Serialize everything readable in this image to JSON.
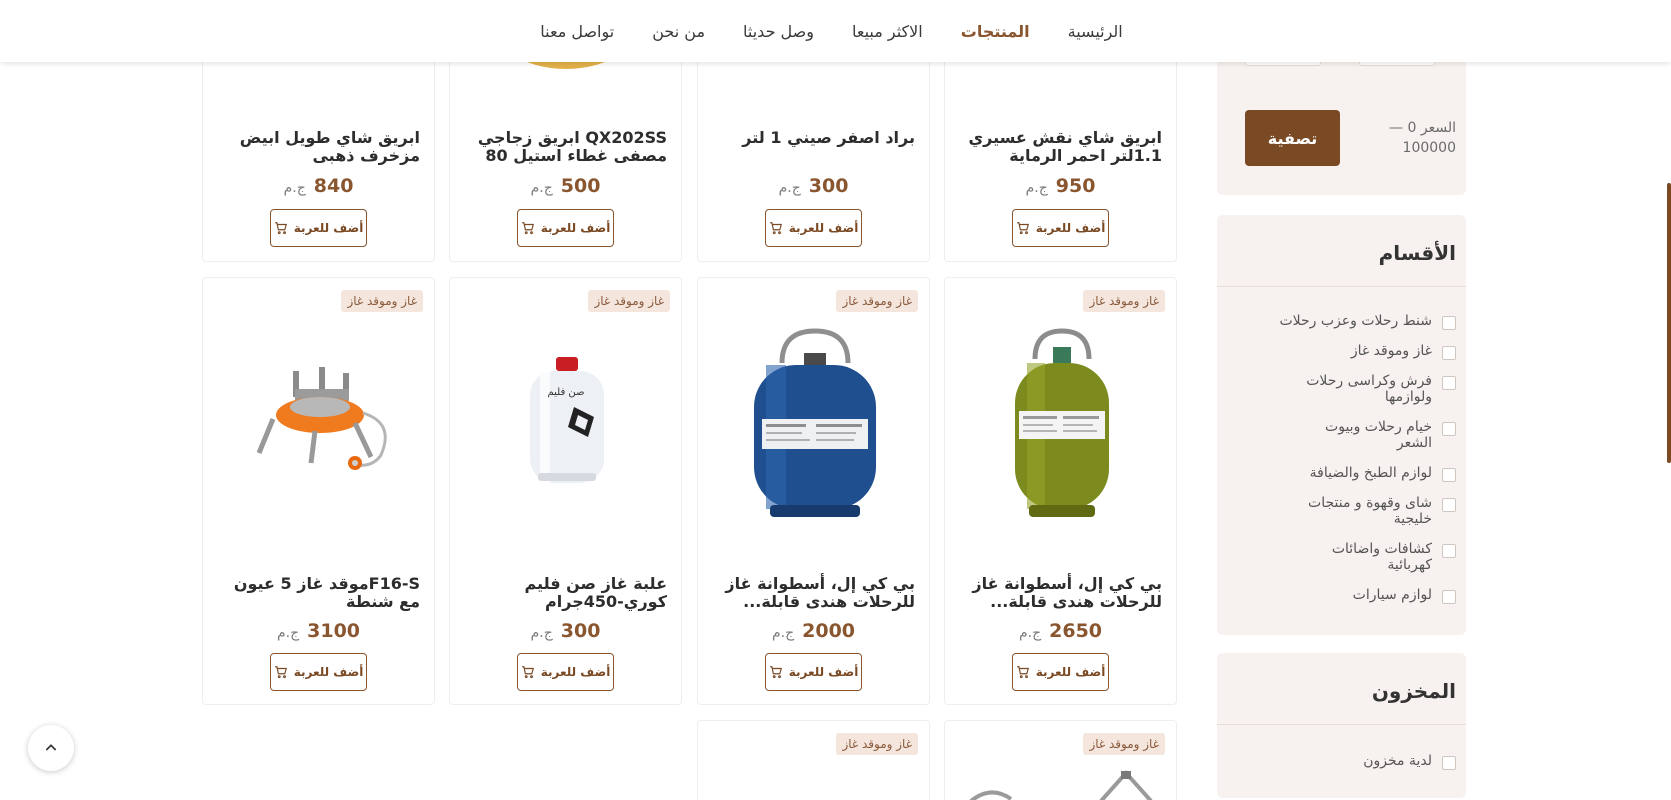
{
  "nav": {
    "items": [
      "الرئيسية",
      "المنتجات",
      "الاكثر مبيعا",
      "وصل حديثا",
      "من نحن",
      "تواصل معنا"
    ],
    "active_index": 1
  },
  "sidebar": {
    "price_filter": {
      "min_value": "0",
      "max_value": "100000",
      "range_label": "السعر 0 — 100000",
      "filter_button": "تصفية"
    },
    "categories": {
      "title": "الأقسام",
      "items": [
        "شنط رحلات وعزب رحلات",
        "غاز وموقد غاز",
        "فرش وكراسى رحلات ولوازمها",
        "خيام رحلات وبيوت الشعر",
        "لوازم الطبخ والضيافة",
        "شاى وقهوة و منتجات خليجية",
        "كشافات واضائات كهربائية",
        "لوازم سيارات"
      ]
    },
    "stock": {
      "title": "المخزون",
      "items": [
        "لدية مخزون"
      ]
    }
  },
  "cart_label": "أضف للعربة",
  "currency": "ج.م",
  "products_row1": [
    {
      "title": "ابريق شاي نقش عسيري 1.1لتر احمر الرماية",
      "price": "950"
    },
    {
      "title": "براد اصفر صيني 1 لتر",
      "price": "300"
    },
    {
      "title": "QX202SS ابريق زجاجي مصفى غطاء استيل 80",
      "price": "500"
    },
    {
      "title": "ابريق شاي طويل ابيض مزخرف ذهبى",
      "price": "840"
    }
  ],
  "products_row2": [
    {
      "badge": "غاز وموقد غاز",
      "title": "بي كي إل، أسطوانة غاز للرحلات هندى قابلة...",
      "price": "2650",
      "image": "olive-gas-cylinder"
    },
    {
      "badge": "غاز وموقد غاز",
      "title": "بي كي إل، أسطوانة غاز للرحلات هندى قابلة...",
      "price": "2000",
      "image": "blue-gas-cylinder"
    },
    {
      "badge": "غاز وموقد غاز",
      "title": "علبة غاز صن فليم كوري-450جرام",
      "price": "300",
      "image": "gas-canister"
    },
    {
      "badge": "غاز وموقد غاز",
      "title": "F16-Sموقد غاز 5 عيون مع شنطة",
      "price": "3100",
      "image": "portable-stove"
    }
  ],
  "products_row3": [
    {
      "badge": "غاز وموقد غاز"
    },
    {
      "badge": "غاز وموقد غاز"
    }
  ],
  "colors": {
    "brand": "#7a4a25",
    "accent": "#8a5630",
    "badge_bg": "#f4e6dd",
    "sidebar_bg": "#f7f2ef"
  }
}
